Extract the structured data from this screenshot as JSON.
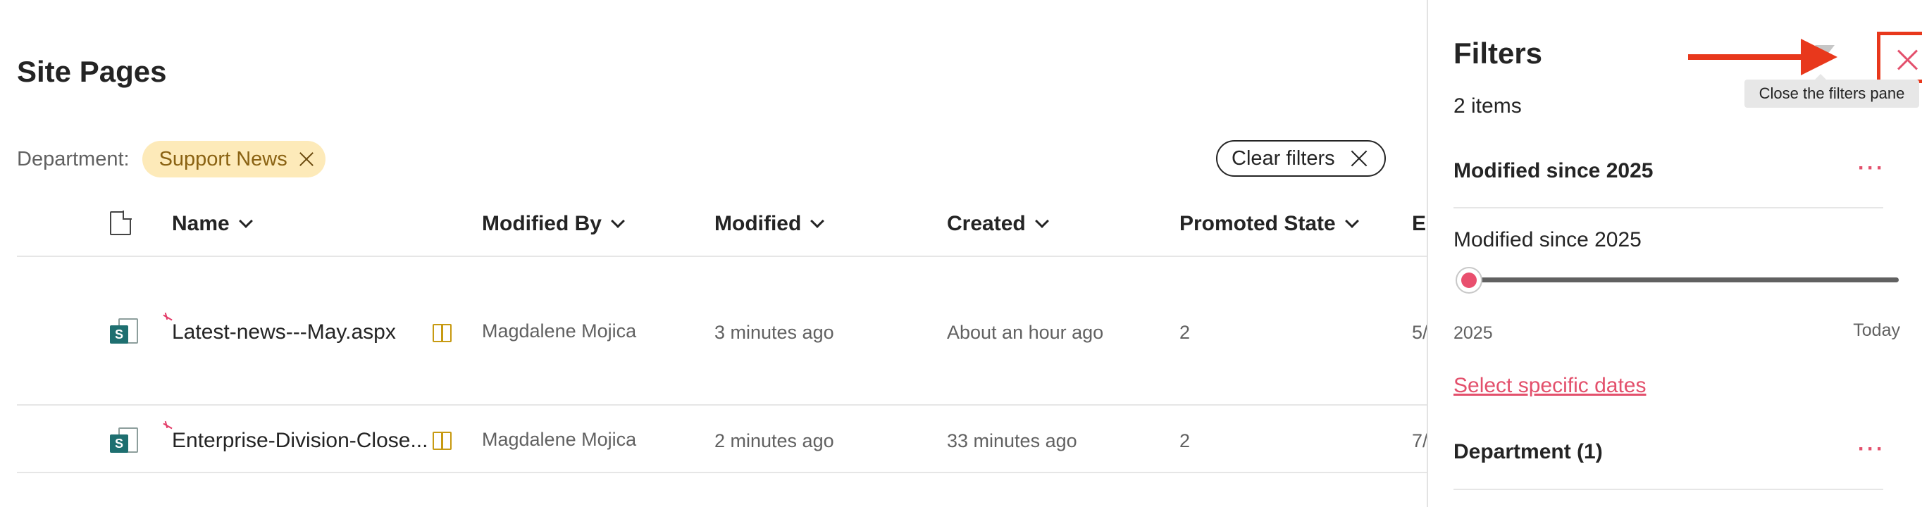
{
  "library": {
    "title": "Site Pages",
    "filter_label": "Department:",
    "active_filter": "Support News",
    "clear_filters_label": "Clear filters"
  },
  "columns": {
    "name": "Name",
    "modified_by": "Modified By",
    "modified": "Modified",
    "created": "Created",
    "promoted_state": "Promoted State",
    "extra": "E"
  },
  "rows": [
    {
      "name": "Latest-news---May.aspx",
      "modified_by": "Magdalene Mojica",
      "modified": "3 minutes ago",
      "created": "About an hour ago",
      "promoted_state": "2",
      "extra": "5/"
    },
    {
      "name": "Enterprise-Division-Close...",
      "modified_by": "Magdalene Mojica",
      "modified": "2 minutes ago",
      "created": "33 minutes ago",
      "promoted_state": "2",
      "extra": "7/"
    }
  ],
  "filters_panel": {
    "title": "Filters",
    "count": "2 items",
    "close_tooltip": "Close the filters pane",
    "modified_section_title": "Modified since 2025",
    "modified_slider_label": "Modified since 2025",
    "slider_min": "2025",
    "slider_max": "Today",
    "slider_value_fraction": 0,
    "select_dates_link": "Select specific dates",
    "department_section_title": "Department (1)",
    "more_glyph": "···"
  },
  "icons": {
    "file_type": "document-icon",
    "sharepoint": "sharepoint-page-icon",
    "new": "new-item-spark-icon",
    "readonly": "book-icon",
    "close": "close-icon",
    "clear": "close-icon",
    "filter_off": "filter-off-icon"
  },
  "colors": {
    "chip_bg": "#fdeab9",
    "accent": "#e3506c",
    "annotation": "#e8381c",
    "sharepoint": "#1e6f70"
  }
}
